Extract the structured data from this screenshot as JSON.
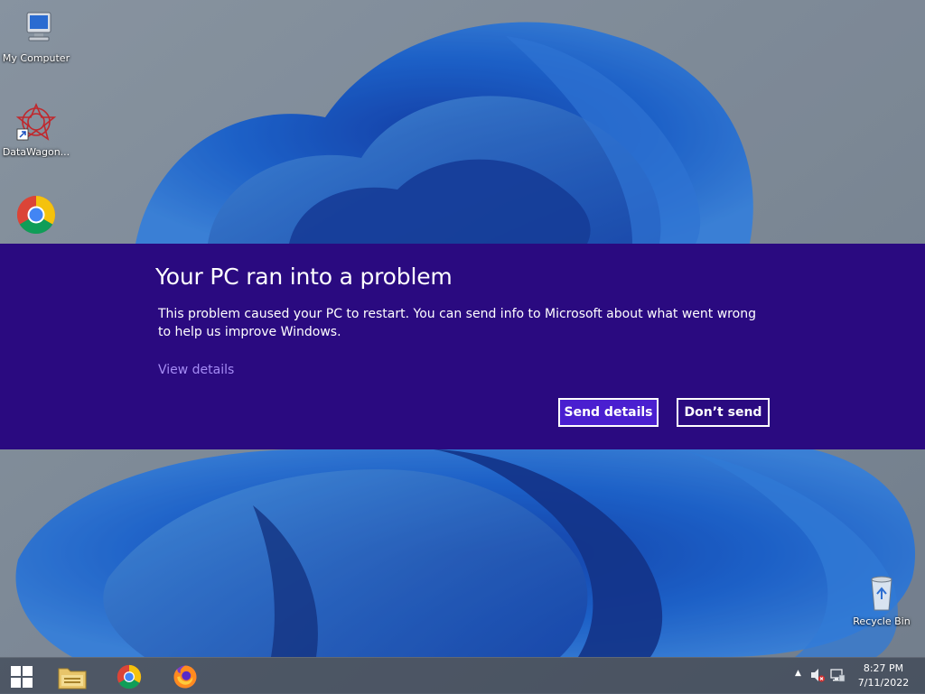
{
  "desktop": {
    "icons": [
      {
        "label": "My Computer",
        "icon": "computer-icon"
      },
      {
        "label": "DataWagon...",
        "icon": "datawagon-icon"
      },
      {
        "label": "",
        "icon": "chrome-icon"
      },
      {
        "label": "Recycle Bin",
        "icon": "recycle-bin-icon"
      }
    ]
  },
  "dialog": {
    "title": "Your PC ran into a problem",
    "message": "This problem caused your PC to restart. You can send info to Microsoft about what went wrong to help us improve Windows.",
    "view_details": "View details",
    "send_button": "Send details",
    "dont_send_button": "Don’t send",
    "colors": {
      "background": "#2a0a80",
      "primary_button": "#4a1fd0",
      "link": "#a58cf5"
    }
  },
  "taskbar": {
    "pinned": [
      "start-icon",
      "file-explorer-icon",
      "chrome-icon",
      "firefox-icon"
    ],
    "tray": [
      "show-hidden-icons-arrow",
      "volume-muted-icon",
      "network-icon"
    ],
    "time": "8:27 PM",
    "date": "7/11/2022"
  }
}
